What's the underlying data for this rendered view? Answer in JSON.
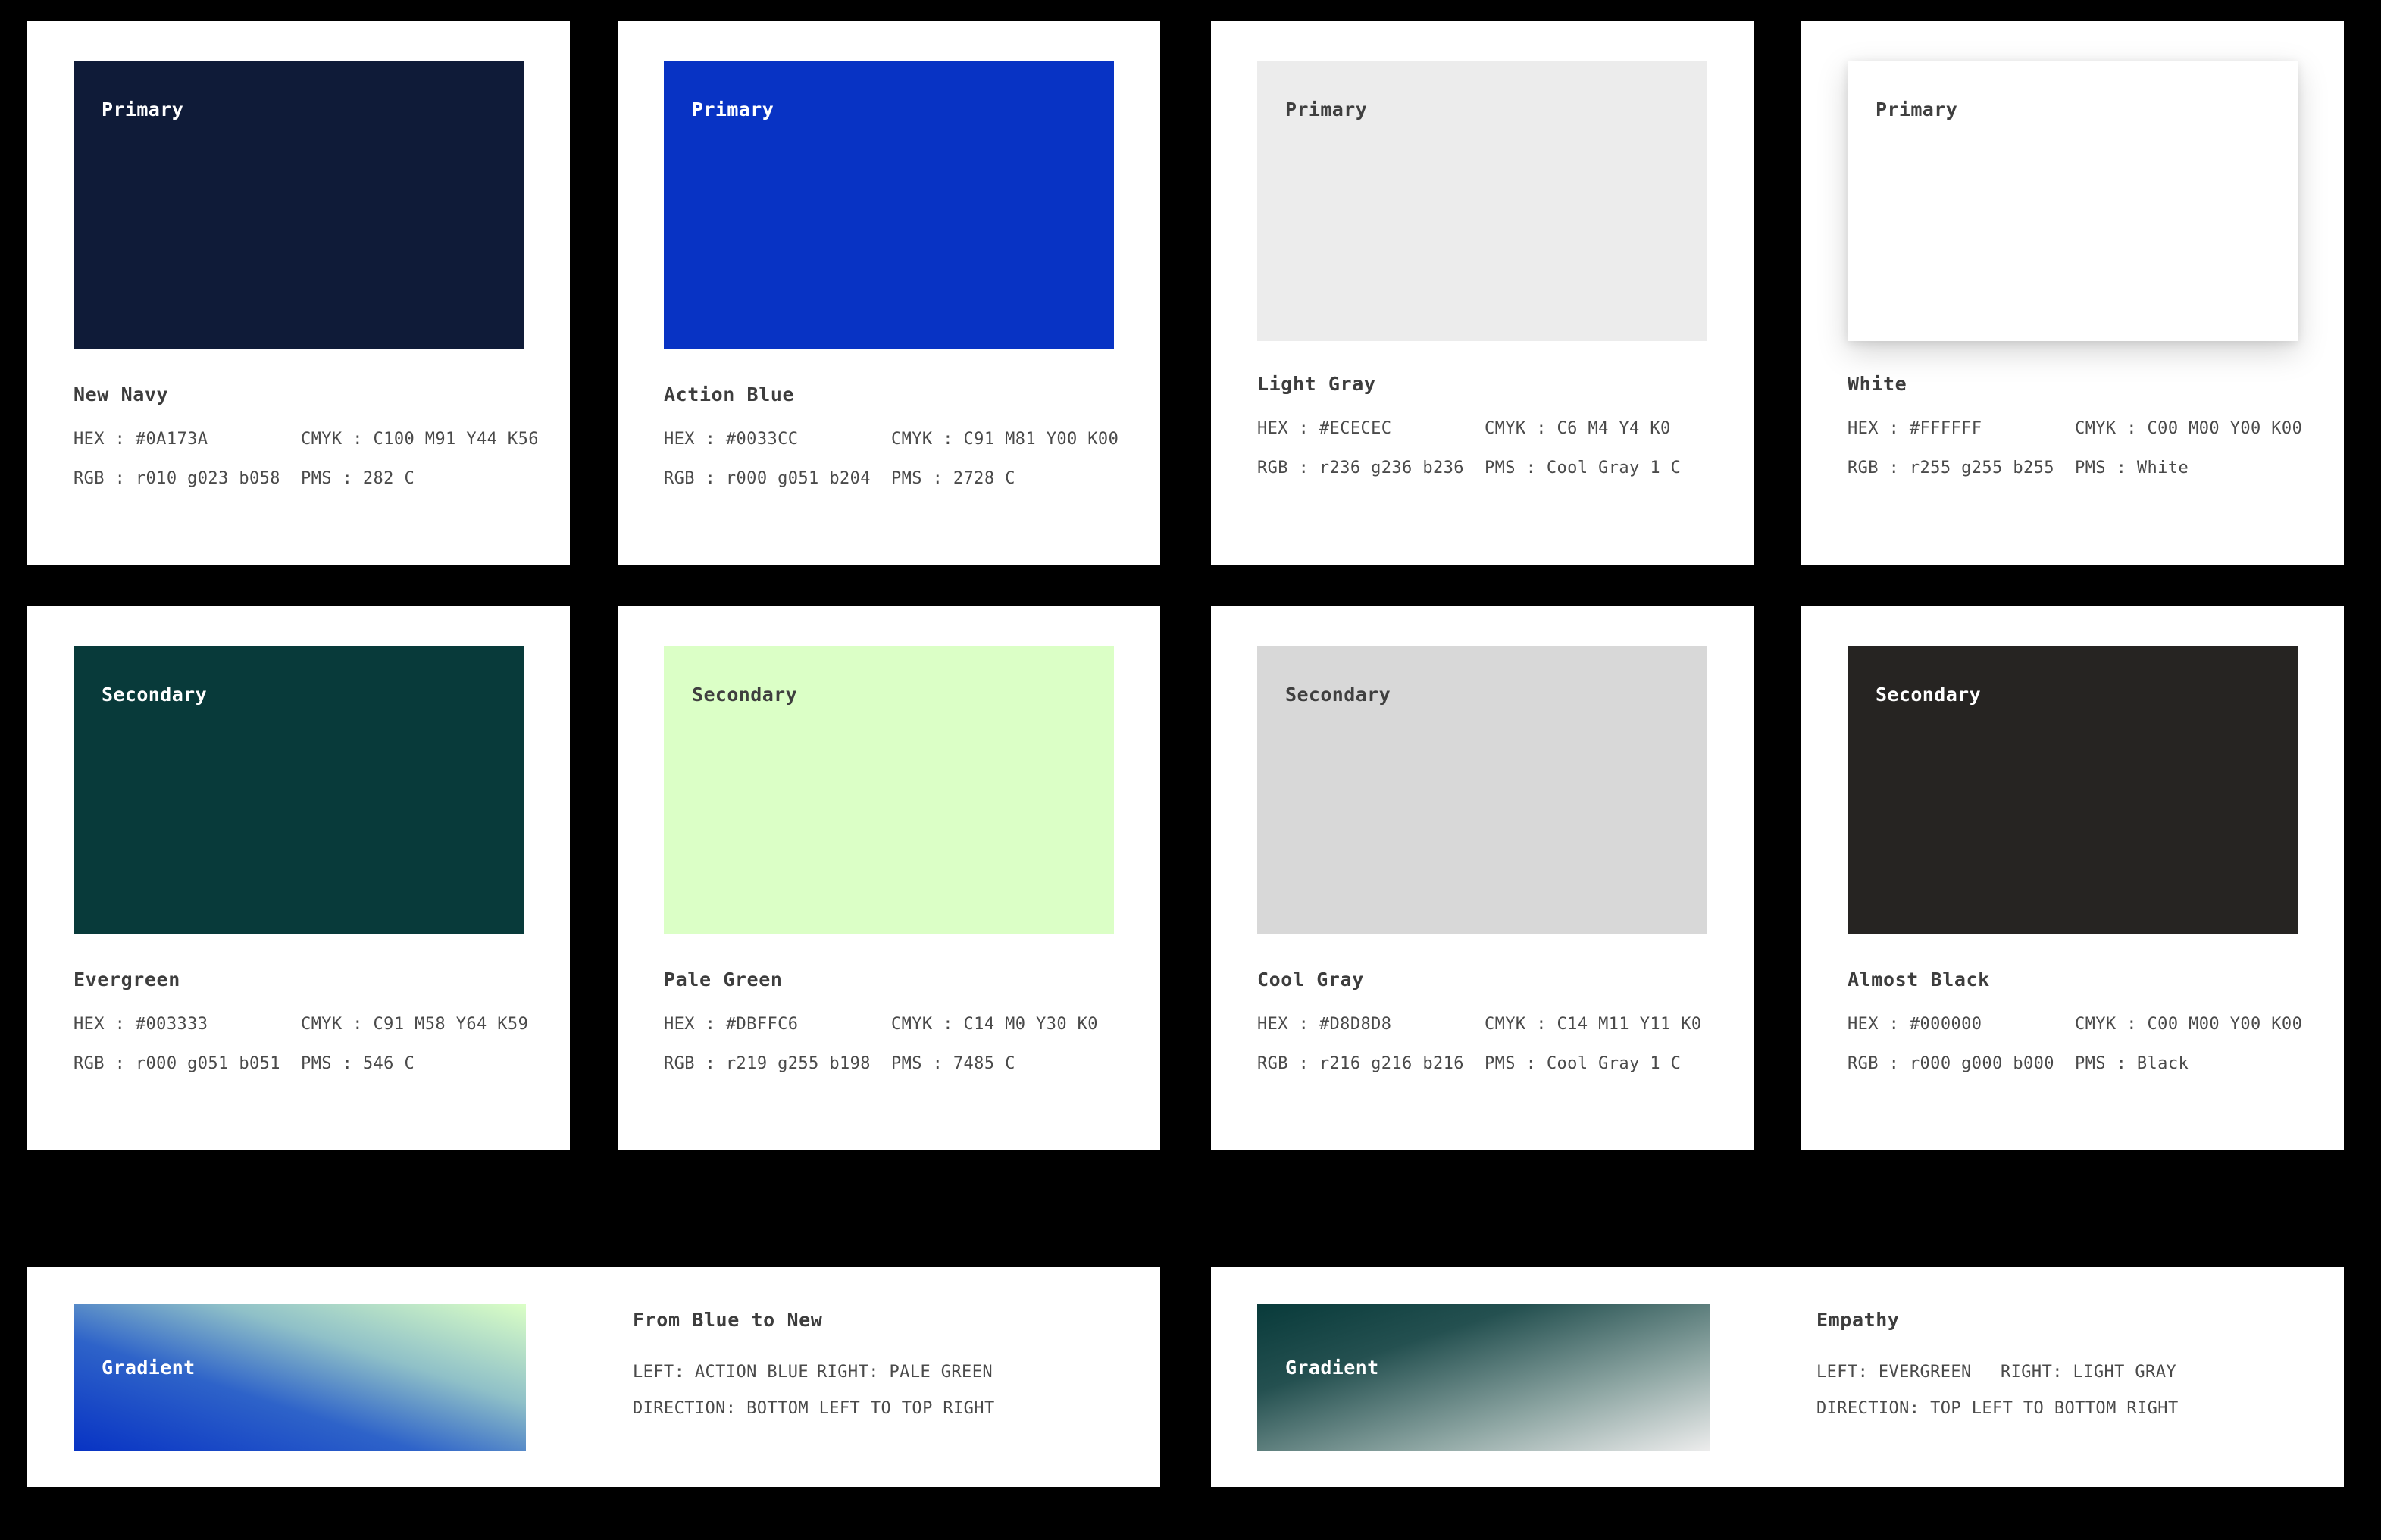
{
  "palette": {
    "swatches": [
      {
        "tier_label": "Primary",
        "name": "New Navy",
        "swatch_color": "#0F1B38",
        "label_on_dark": true,
        "hex_key": "HEX :",
        "hex_value": "#0A173A",
        "cmyk_key": "CMYK :",
        "cmyk_value": "C100 M91 Y44 K56",
        "rgb_key": "RGB :",
        "rgb_value": "r010 g023 b058",
        "pms_key": "PMS :",
        "pms_value": "282 C"
      },
      {
        "tier_label": "Primary",
        "name": "Action Blue",
        "swatch_color": "#0833C4",
        "label_on_dark": true,
        "hex_key": "HEX :",
        "hex_value": "#0033CC",
        "cmyk_key": "CMYK :",
        "cmyk_value": "C91 M81 Y00 K00",
        "rgb_key": "RGB :",
        "rgb_value": "r000 g051 b204",
        "pms_key": "PMS :",
        "pms_value": "2728 C"
      },
      {
        "tier_label": "Primary",
        "name": "Light Gray",
        "swatch_color": "#ECECEC",
        "label_on_dark": false,
        "hex_key": "HEX :",
        "hex_value": "#ECECEC",
        "cmyk_key": "CMYK :",
        "cmyk_value": "C6 M4 Y4 K0",
        "rgb_key": "RGB :",
        "rgb_value": "r236 g236 b236",
        "pms_key": "PMS :",
        "pms_value": "Cool Gray 1 C"
      },
      {
        "tier_label": "Primary",
        "name": "White",
        "swatch_color": "#FFFFFF",
        "label_on_dark": false,
        "hex_key": "HEX :",
        "hex_value": "#FFFFFF",
        "cmyk_key": "CMYK :",
        "cmyk_value": "C00 M00 Y00 K00",
        "rgb_key": "RGB :",
        "rgb_value": "r255 g255 b255",
        "pms_key": "PMS :",
        "pms_value": "White"
      },
      {
        "tier_label": "Secondary",
        "name": "Evergreen",
        "swatch_color": "#083A3A",
        "label_on_dark": true,
        "hex_key": "HEX :",
        "hex_value": "#003333",
        "cmyk_key": "CMYK :",
        "cmyk_value": "C91 M58 Y64 K59",
        "rgb_key": "RGB :",
        "rgb_value": "r000 g051 b051",
        "pms_key": "PMS :",
        "pms_value": "546 C"
      },
      {
        "tier_label": "Secondary",
        "name": "Pale Green",
        "swatch_color": "#DBFFC6",
        "label_on_dark": false,
        "hex_key": "HEX :",
        "hex_value": "#DBFFC6",
        "cmyk_key": "CMYK :",
        "cmyk_value": "C14 M0 Y30 K0",
        "rgb_key": "RGB :",
        "rgb_value": "r219 g255 b198",
        "pms_key": "PMS :",
        "pms_value": "7485 C"
      },
      {
        "tier_label": "Secondary",
        "name": "Cool Gray",
        "swatch_color": "#D8D8D8",
        "label_on_dark": false,
        "hex_key": "HEX :",
        "hex_value": "#D8D8D8",
        "cmyk_key": "CMYK :",
        "cmyk_value": "C14 M11 Y11 K0",
        "rgb_key": "RGB :",
        "rgb_value": "r216 g216 b216",
        "pms_key": "PMS :",
        "pms_value": "Cool Gray 1 C"
      },
      {
        "tier_label": "Secondary",
        "name": "Almost Black",
        "swatch_color": "#262422",
        "label_on_dark": true,
        "hex_key": "HEX :",
        "hex_value": "#000000",
        "cmyk_key": "CMYK :",
        "cmyk_value": "C00 M00 Y00 K00",
        "rgb_key": "RGB :",
        "rgb_value": "r000 g000 b000",
        "pms_key": "PMS :",
        "pms_value": "Black"
      }
    ],
    "gradients": [
      {
        "tier_label": "Gradient",
        "name": "From Blue to New",
        "left_key": "LEFT:",
        "left_value": "ACTION BLUE",
        "right_key": "RIGHT:",
        "right_value": "PALE GREEN",
        "direction_key": "DIRECTION:",
        "direction_value": "BOTTOM LEFT TO TOP RIGHT",
        "from_color": "#0833C4",
        "to_color": "#DBFFC6",
        "css_angle": "to top right"
      },
      {
        "tier_label": "Gradient",
        "name": "Empathy",
        "left_key": "LEFT:",
        "left_value": "EVERGREEN",
        "right_key": "RIGHT:",
        "right_value": "LIGHT GRAY",
        "direction_key": "DIRECTION:",
        "direction_value": "TOP LEFT TO BOTTOM RIGHT",
        "from_color": "#083A3A",
        "to_color": "#ECECEC",
        "css_angle": "to bottom right"
      }
    ]
  }
}
